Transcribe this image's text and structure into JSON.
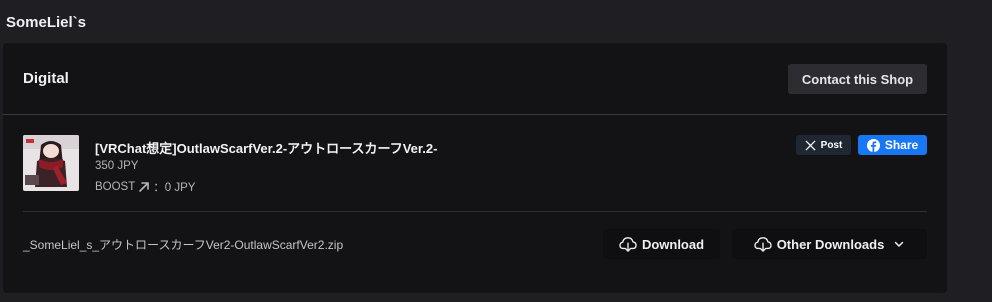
{
  "shop": {
    "name": "SomeLiel`s"
  },
  "card": {
    "title": "Digital",
    "contact_label": "Contact this Shop"
  },
  "item": {
    "title": "[VRChat想定]OutlawScarfVer.2-アウトロースカーフVer.2-",
    "price": "350 JPY",
    "boost_label": "BOOST",
    "boost_value": "：0 JPY",
    "thumbnail_icon": "product-thumbnail"
  },
  "share": {
    "x_label": "Post",
    "fb_label": "Share",
    "fb_color": "#1877f2"
  },
  "file": {
    "name": "_SomeLiel_s_アウトロースカーフVer2-OutlawScarfVer2.zip",
    "download_label": "Download",
    "other_downloads_label": "Other Downloads"
  },
  "colors": {
    "background": "#1f1f23",
    "card": "#131315",
    "accent": "#1877f2"
  }
}
